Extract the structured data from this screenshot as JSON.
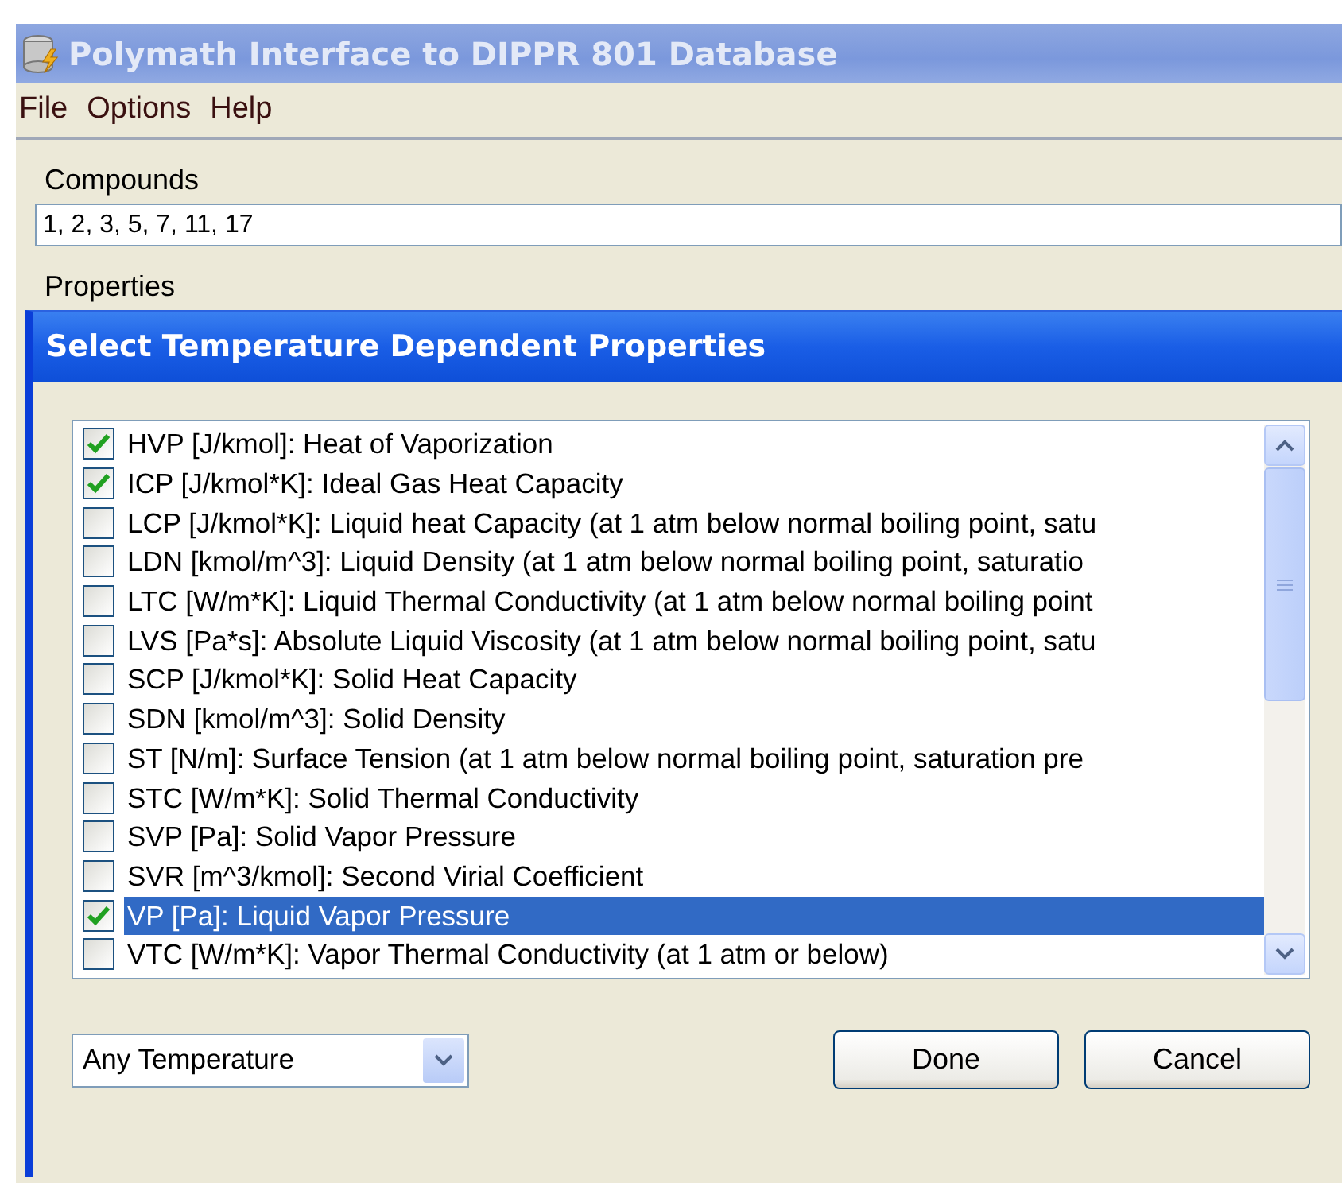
{
  "window": {
    "title": "Polymath Interface to DIPPR 801 Database"
  },
  "menu": [
    "File",
    "Options",
    "Help"
  ],
  "compounds": {
    "label": "Compounds",
    "value": "1, 2, 3, 5, 7, 11, 17"
  },
  "properties_label": "Properties",
  "dialog": {
    "title": "Select Temperature Dependent Properties",
    "items": [
      {
        "label": "HVP [J/kmol]: Heat of Vaporization",
        "checked": true,
        "selected": false
      },
      {
        "label": "ICP [J/kmol*K]: Ideal Gas Heat Capacity",
        "checked": true,
        "selected": false
      },
      {
        "label": "LCP [J/kmol*K]: Liquid heat Capacity (at 1 atm below normal boiling point, satu",
        "checked": false,
        "selected": false
      },
      {
        "label": "LDN [kmol/m^3]: Liquid Density (at 1 atm below normal boiling point, saturatio",
        "checked": false,
        "selected": false
      },
      {
        "label": "LTC [W/m*K]: Liquid Thermal Conductivity (at 1 atm below normal boiling point",
        "checked": false,
        "selected": false
      },
      {
        "label": "LVS [Pa*s]: Absolute Liquid Viscosity (at 1 atm below normal boiling point, satu",
        "checked": false,
        "selected": false
      },
      {
        "label": "SCP [J/kmol*K]: Solid Heat Capacity",
        "checked": false,
        "selected": false
      },
      {
        "label": "SDN [kmol/m^3]: Solid Density",
        "checked": false,
        "selected": false
      },
      {
        "label": "ST [N/m]: Surface Tension (at 1 atm below normal boiling point, saturation pre",
        "checked": false,
        "selected": false
      },
      {
        "label": "STC [W/m*K]: Solid Thermal Conductivity",
        "checked": false,
        "selected": false
      },
      {
        "label": "SVP [Pa]: Solid Vapor Pressure",
        "checked": false,
        "selected": false
      },
      {
        "label": "SVR [m^3/kmol]: Second Virial Coefficient",
        "checked": false,
        "selected": false
      },
      {
        "label": "VP [Pa]: Liquid Vapor Pressure",
        "checked": true,
        "selected": true
      },
      {
        "label": "VTC [W/m*K]: Vapor Thermal Conductivity (at 1 atm or below)",
        "checked": false,
        "selected": false
      }
    ],
    "temperature_select": {
      "value": "Any Temperature"
    },
    "buttons": [
      "Done",
      "Cancel"
    ]
  }
}
